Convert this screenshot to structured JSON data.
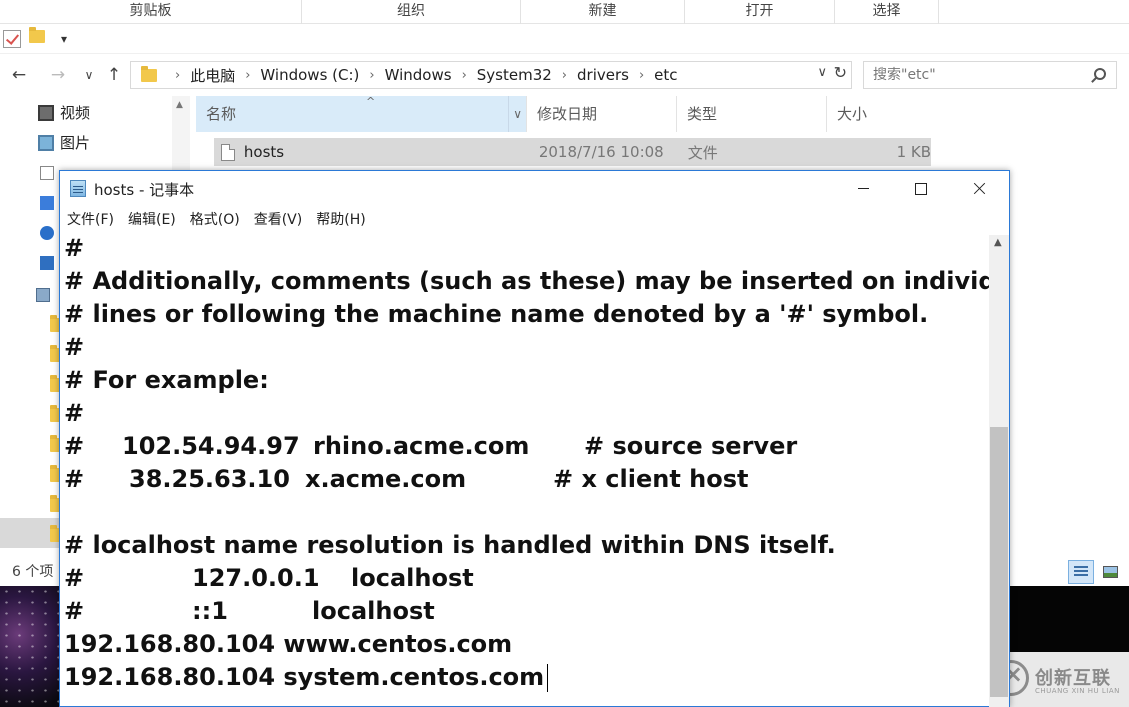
{
  "explorer": {
    "ribbon_groups": [
      "剪贴板",
      "组织",
      "新建",
      "打开",
      "选择"
    ],
    "breadcrumbs": [
      "此电脑",
      "Windows (C:)",
      "Windows",
      "System32",
      "drivers",
      "etc"
    ],
    "search_placeholder": "搜索\"etc\"",
    "nav_items": [
      "视频",
      "图片"
    ],
    "columns": {
      "name": "名称",
      "date": "修改日期",
      "type": "类型",
      "size": "大小"
    },
    "files": [
      {
        "name": "hosts",
        "date": "2018/7/16 10:08",
        "type": "文件",
        "size": "1 KB"
      }
    ],
    "status": "6 个项"
  },
  "notepad": {
    "title": "hosts - 记事本",
    "menus": [
      "文件(F)",
      "编辑(E)",
      "格式(O)",
      "查看(V)",
      "帮助(H)"
    ],
    "lines": [
      "#",
      "# Additionally, comments (such as these) may be inserted on individual",
      "# lines or following the machine name denoted by a '#' symbol.",
      "#",
      "# For example:",
      "#",
      {
        "hash": "#",
        "ip": "102.54.94.97",
        "host": "rhino.acme.com",
        "comment": "# source server"
      },
      {
        "hash": "#",
        "ip": "38.25.63.10",
        "host": "x.acme.com",
        "comment": "# x client host"
      },
      "",
      "# localhost name resolution is handled within DNS itself.",
      {
        "hash": "#",
        "ip": "127.0.0.1",
        "host": "localhost"
      },
      {
        "hash": "#",
        "ip": "::1",
        "host": "localhost"
      },
      "192.168.80.104 www.centos.com",
      "192.168.80.104 system.centos.com"
    ]
  },
  "watermark": {
    "brand": "创新互联",
    "sub": "CHUANG XIN HU LIAN"
  }
}
